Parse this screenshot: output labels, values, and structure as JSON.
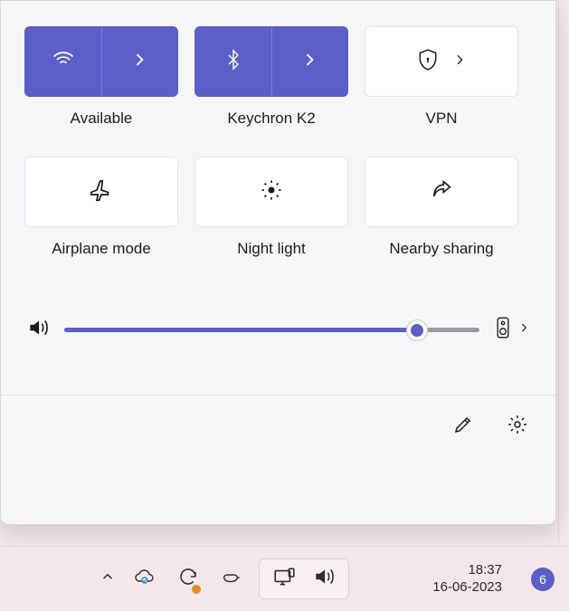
{
  "colors": {
    "accent": "#5b5fc7"
  },
  "tiles": {
    "wifi": {
      "label": "Available",
      "active": true,
      "expandable": true
    },
    "bluetooth": {
      "label": "Keychron K2",
      "active": true,
      "expandable": true
    },
    "vpn": {
      "label": "VPN",
      "active": false,
      "expandable": true
    },
    "airplane": {
      "label": "Airplane mode",
      "active": false
    },
    "nightlight": {
      "label": "Night light",
      "active": false
    },
    "nearby": {
      "label": "Nearby sharing",
      "active": false
    }
  },
  "volume": {
    "percent": 85
  },
  "taskbar": {
    "time": "18:37",
    "date": "16-06-2023",
    "notification_count": "6"
  }
}
